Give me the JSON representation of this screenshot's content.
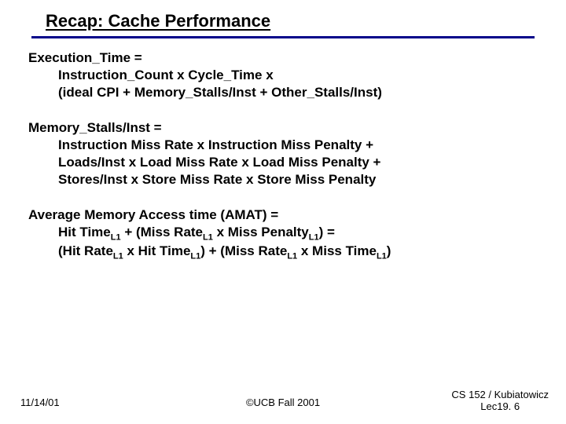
{
  "title": "Recap: Cache Performance",
  "block1": {
    "l1": "Execution_Time =",
    "l2": "Instruction_Count x Cycle_Time x",
    "l3": "(ideal CPI + Memory_Stalls/Inst + Other_Stalls/Inst)"
  },
  "block2": {
    "l1": "Memory_Stalls/Inst =",
    "l2": "Instruction Miss Rate x Instruction Miss Penalty +",
    "l3": "Loads/Inst x Load Miss Rate x Load Miss Penalty +",
    "l4": "Stores/Inst x Store Miss Rate x Store Miss Penalty"
  },
  "block3": {
    "l1": "Average Memory Access time (AMAT) =",
    "l2a": "Hit Time",
    "l2b": " + (Miss Rate",
    "l2c": " x Miss Penalty",
    "l2d": ") =",
    "l3a": "(Hit Rate",
    "l3b": " x Hit Time",
    "l3c": ") + (Miss Rate",
    "l3d": " x Miss Time",
    "l3e": ")",
    "sub": "L1"
  },
  "footer": {
    "date": "11/14/01",
    "center": "©UCB Fall 2001",
    "right1": "CS 152 / Kubiatowicz",
    "right2": "Lec19. 6"
  }
}
